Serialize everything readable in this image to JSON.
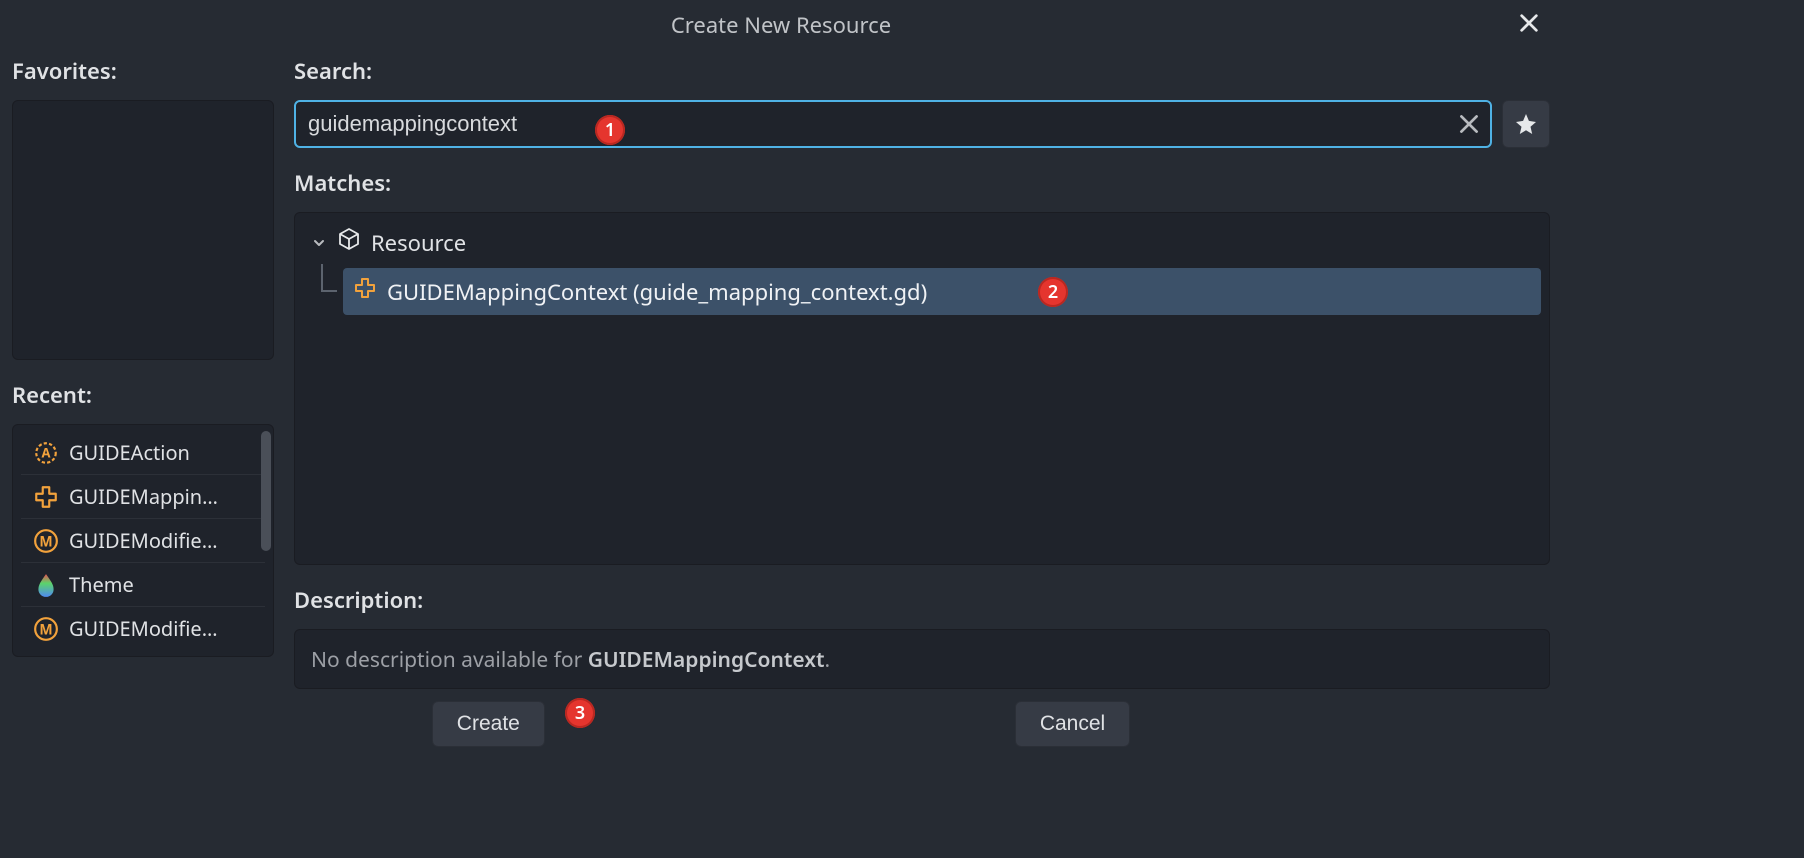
{
  "title": "Create New Resource",
  "left": {
    "favorites_label": "Favorites:",
    "recent_label": "Recent:",
    "recent": [
      {
        "icon": "action-gear",
        "label": "GUIDEAction"
      },
      {
        "icon": "dpad",
        "label": "GUIDEMappin…"
      },
      {
        "icon": "circle-m",
        "label": "GUIDEModifie…"
      },
      {
        "icon": "theme-drop",
        "label": "Theme"
      },
      {
        "icon": "circle-m",
        "label": "GUIDEModifie…"
      }
    ]
  },
  "search": {
    "label": "Search:",
    "value": "guidemappingcontext"
  },
  "matches": {
    "label": "Matches:",
    "parent": "Resource",
    "child": "GUIDEMappingContext (guide_mapping_context.gd)"
  },
  "description": {
    "label": "Description:",
    "prefix": "No description available for ",
    "class": "GUIDEMappingContext",
    "suffix": "."
  },
  "buttons": {
    "create": "Create",
    "cancel": "Cancel"
  },
  "badges": {
    "b1": "1",
    "b2": "2",
    "b3": "3"
  }
}
